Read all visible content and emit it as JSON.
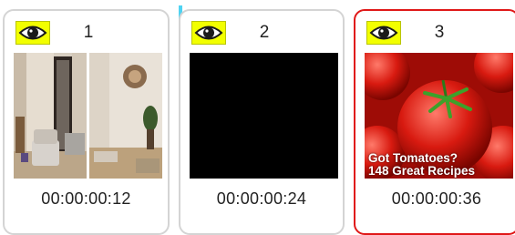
{
  "timeline": {
    "frames": [
      {
        "number": "1",
        "timecode": "00:00:00:12",
        "thumbnail": "interior-rooms-photo",
        "selected": false
      },
      {
        "number": "2",
        "timecode": "00:00:00:24",
        "thumbnail": "black-frame",
        "selected": false
      },
      {
        "number": "3",
        "timecode": "00:00:00:36",
        "thumbnail": "tomatoes-photo",
        "selected": true,
        "overlay_line1": "Got Tomatoes?",
        "overlay_line2": "148 Great Recipes"
      }
    ],
    "colors": {
      "selection_border": "#e01818",
      "insertion_marker": "#4fd3f2",
      "eye_badge": "#f2ff00"
    },
    "icons": {
      "visibility": "eye-icon"
    }
  }
}
